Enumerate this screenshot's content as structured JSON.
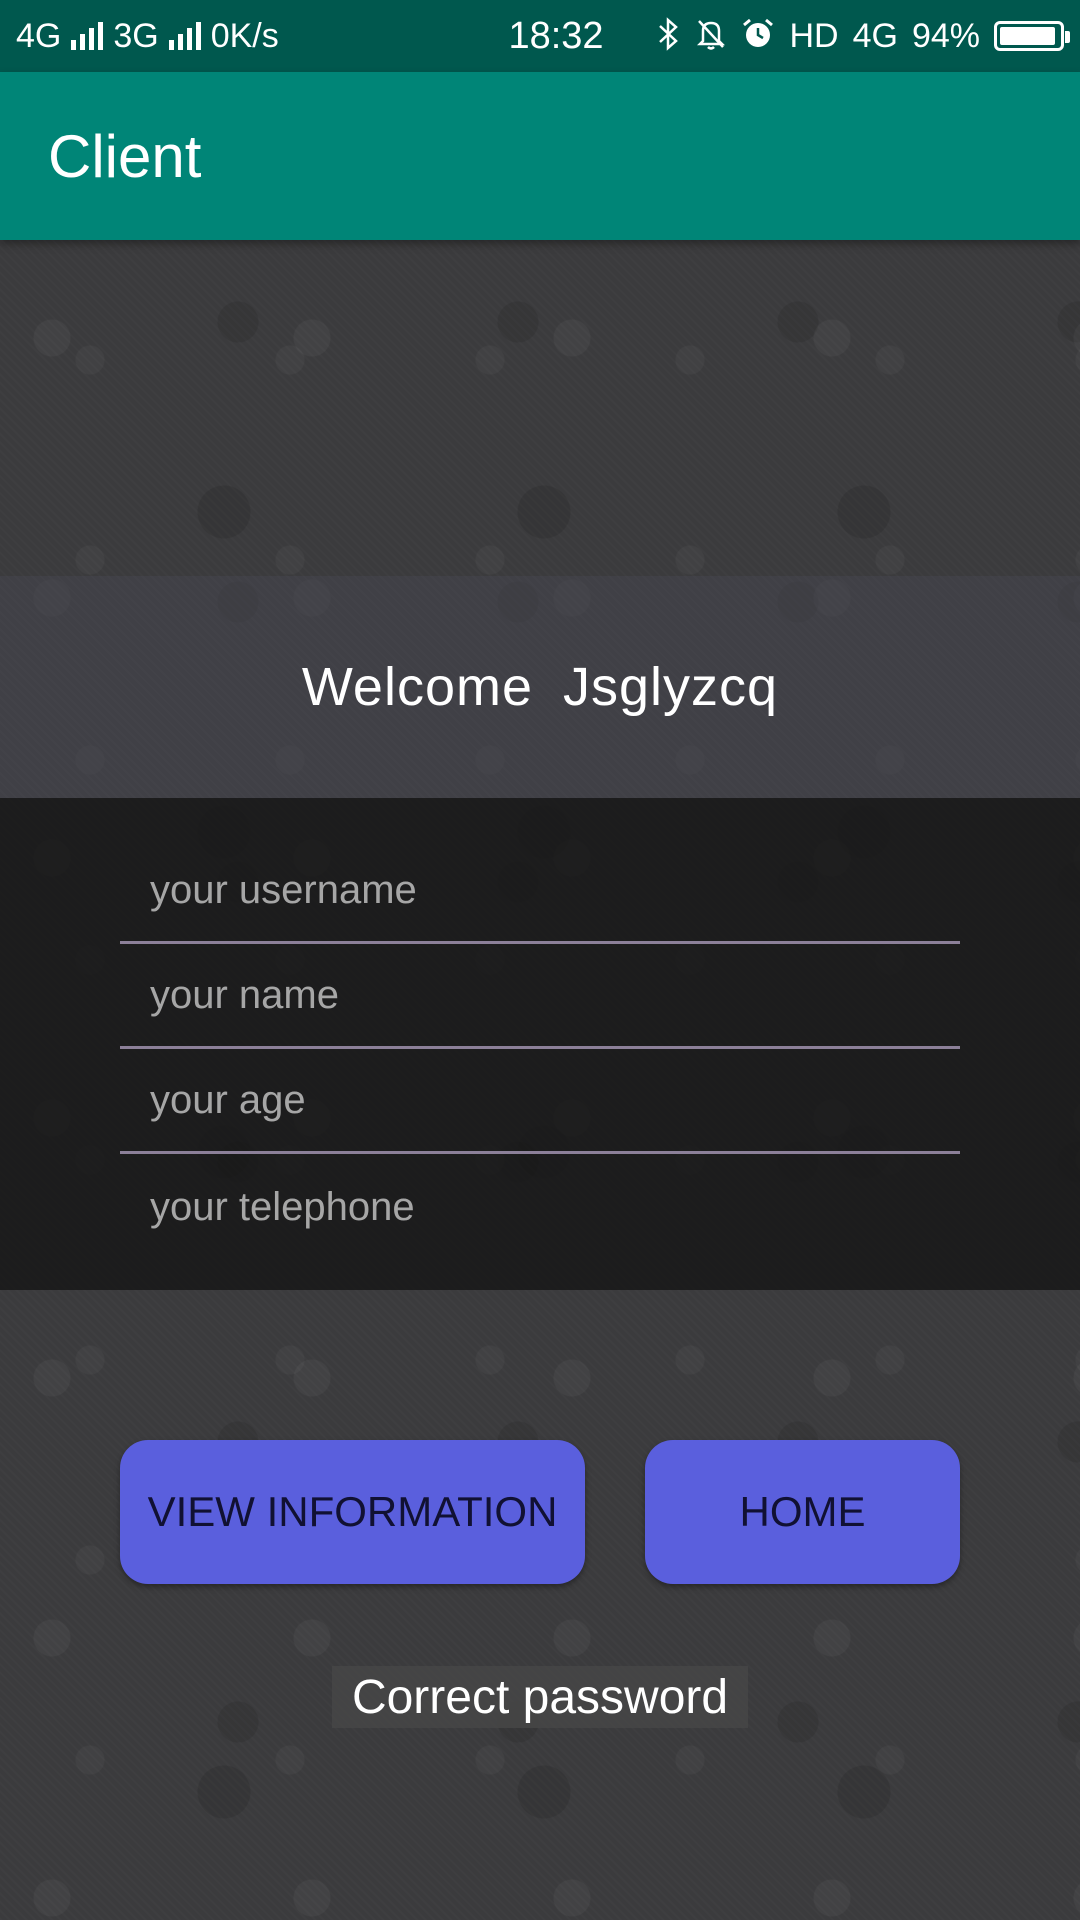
{
  "status_bar": {
    "network_1": "4G",
    "network_2": "3G",
    "speed": "0K/s",
    "time": "18:32",
    "hd_label": "HD",
    "network_3": "4G",
    "battery_text": "94%",
    "battery_level": 0.94,
    "icons": [
      "bluetooth-icon",
      "notifications-off-icon",
      "alarm-icon"
    ]
  },
  "app_bar": {
    "title": "Client",
    "color": "#008577"
  },
  "welcome": {
    "greeting": "Welcome",
    "username": "Jsglyzcq"
  },
  "form": {
    "username_placeholder": "your username",
    "name_placeholder": "your name",
    "age_placeholder": "your age",
    "telephone_placeholder": "your telephone"
  },
  "buttons": {
    "view_information": "VIEW INFORMATION",
    "home": "HOME",
    "color": "#5a5fdd"
  },
  "status_message": "Correct password"
}
